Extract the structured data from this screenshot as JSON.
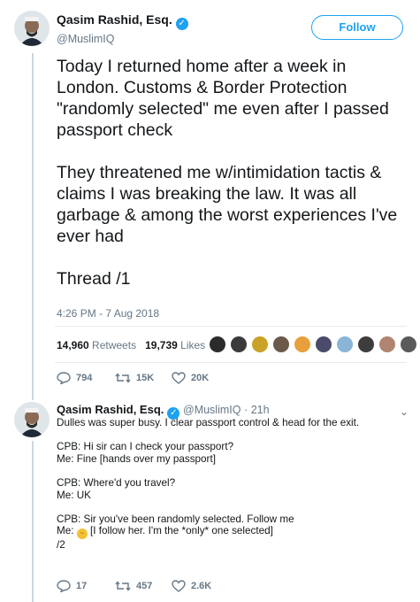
{
  "tweet": {
    "author_name": "Qasim Rashid, Esq.",
    "author_handle": "@MuslimIQ",
    "follow_label": "Follow",
    "text": "Today I returned home after a week in London. Customs & Border Protection \"randomly selected\" me even after I passed passport check\n\nThey threatened me w/intimidation tactis & claims I was breaking the law. It was all garbage & among the worst experiences I've ever had\n\nThread /1",
    "timestamp": "4:26 PM - 7 Aug 2018",
    "retweets_count": "14,960",
    "retweets_label": "Retweets",
    "likes_count": "19,739",
    "likes_label": "Likes",
    "actions": {
      "replies": "794",
      "retweets": "15K",
      "likes": "20K"
    },
    "liker_avatar_colors": [
      "#2b2b2b",
      "#3a3a3a",
      "#c9a227",
      "#6b5a4a",
      "#e8a03c",
      "#4a4a6a",
      "#8bb5d6",
      "#3d3d3d",
      "#b08470",
      "#5a5a5a"
    ]
  },
  "reply": {
    "author_name": "Qasim Rashid, Esq.",
    "author_handle": "@MuslimIQ",
    "time": "· 21h",
    "lines": [
      "Dulles was super busy. I clear passport control & head for the exit.",
      "",
      "CPB: Hi sir can I check your passport?",
      "Me: Fine [hands over my passport]",
      "",
      "CPB: Where'd you travel?",
      "Me: UK",
      "",
      "CPB: Sir you've been randomly selected. Follow me"
    ],
    "me_prefix": "Me:",
    "me_suffix": "[I follow her. I'm the *only* one selected]",
    "thread_marker": "/2",
    "actions": {
      "replies": "17",
      "retweets": "457",
      "likes": "2.6K"
    }
  },
  "colors": {
    "accent": "#1da1f2",
    "muted": "#657786",
    "text": "#14171a"
  }
}
